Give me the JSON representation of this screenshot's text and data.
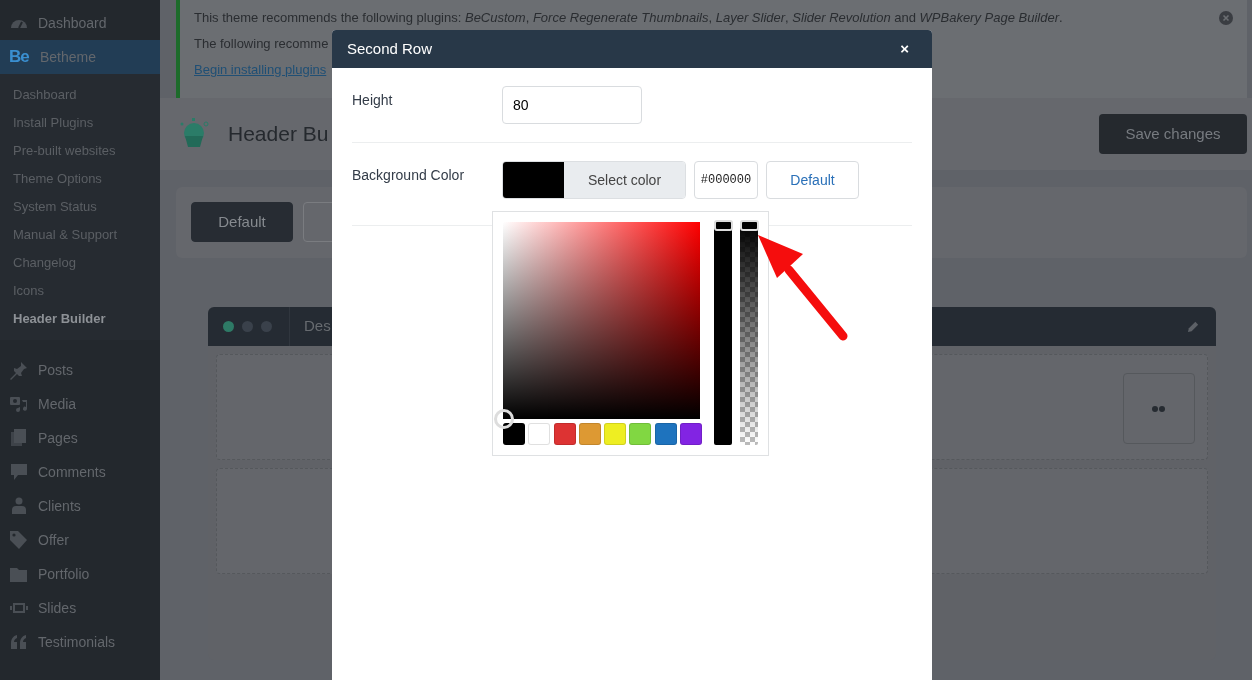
{
  "sidebar": {
    "items": [
      {
        "label": "Dashboard",
        "selected": false
      },
      {
        "label": "Betheme",
        "logo": "Be",
        "selected": true,
        "children": [
          {
            "label": "Dashboard",
            "selected": false
          },
          {
            "label": "Install Plugins",
            "selected": false
          },
          {
            "label": "Pre-built websites",
            "selected": false
          },
          {
            "label": "Theme Options",
            "selected": false
          },
          {
            "label": "System Status",
            "selected": false
          },
          {
            "label": "Manual & Support",
            "selected": false
          },
          {
            "label": "Changelog",
            "selected": false
          },
          {
            "label": "Icons",
            "selected": false
          },
          {
            "label": "Header Builder",
            "selected": true
          }
        ]
      },
      {
        "label": "Posts",
        "selected": false
      },
      {
        "label": "Media",
        "selected": false
      },
      {
        "label": "Pages",
        "selected": false
      },
      {
        "label": "Comments",
        "selected": false
      },
      {
        "label": "Clients",
        "selected": false
      },
      {
        "label": "Offer",
        "selected": false
      },
      {
        "label": "Portfolio",
        "selected": false
      },
      {
        "label": "Slides",
        "selected": false
      },
      {
        "label": "Testimonials",
        "selected": false
      }
    ]
  },
  "notice": {
    "lines": [
      "This theme recommends the following plugins: *BeCustom*, *Force Regenerate Thumbnails*, *Layer Slider*, *Slider Revolution* and *WPBakery Page Builder*.",
      "The following recomme"
    ],
    "link": "Begin installing plugins"
  },
  "page_header": {
    "title": "Header Bu",
    "save_button": "Save changes"
  },
  "tabs": [
    {
      "label": "Default",
      "selected": true
    },
    {
      "selected": false
    }
  ],
  "builder_card": {
    "title": "Des",
    "indicators": [
      {
        "on": true
      },
      {
        "on": false
      },
      {
        "on": false
      }
    ]
  },
  "modal": {
    "title": "Second Row",
    "close": "×",
    "fields": [
      {
        "kind": "number",
        "label": "Height",
        "value": "80"
      },
      {
        "kind": "color",
        "label": "Background Color",
        "button": "Select color",
        "value": "#000000",
        "default_button": "Default"
      }
    ]
  },
  "color_picker": {
    "hue_slider": {
      "level": 1
    },
    "alpha_slider": {
      "level": 1
    },
    "swatches": [
      {
        "color": "#000000"
      },
      {
        "color": "#ffffff"
      },
      {
        "color": "#dd3333"
      },
      {
        "color": "#dd9933"
      },
      {
        "color": "#eeee22"
      },
      {
        "color": "#81d742"
      },
      {
        "color": "#1e73be"
      },
      {
        "color": "#8224e3"
      }
    ]
  }
}
